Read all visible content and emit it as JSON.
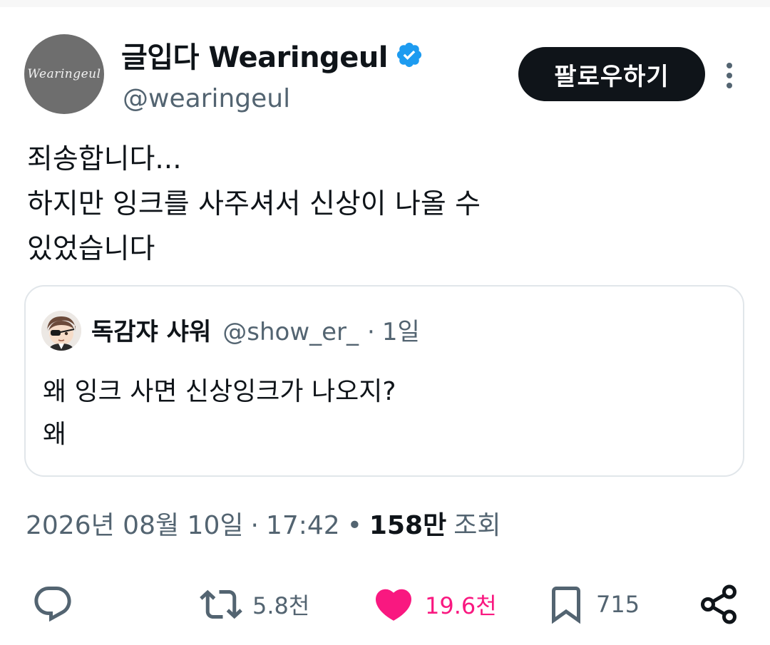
{
  "author": {
    "display_name": "글입다 Wearingeul",
    "handle": "@wearingeul",
    "avatar_text": "Wearingeul",
    "verified": true
  },
  "follow_button": {
    "label": "팔로우하기"
  },
  "tweet": {
    "lines": [
      "죄송합니다...",
      "하지만 잉크를 사주셔서 신상이 나올 수",
      "있었습니다"
    ]
  },
  "quote": {
    "display_name": "독감쟈 샤워",
    "handle": "@show_er_",
    "separator": "·",
    "time": "1일",
    "lines": [
      "왜 잉크 사면 신상잉크가 나오지?",
      "왜"
    ]
  },
  "meta": {
    "date": "2026년 08월 10일",
    "sep1": "·",
    "time": "17:42",
    "sep2": "•",
    "views_count": "158만",
    "views_label": "조회"
  },
  "actions": {
    "reply_count": "",
    "retweet_count": "5.8천",
    "like_count": "19.6천",
    "bookmark_count": "715",
    "liked": true
  },
  "colors": {
    "text": "#0f1419",
    "secondary": "#536471",
    "verified_blue": "#1d9bf0",
    "like_pink": "#f91880",
    "border": "#e1e6ea"
  },
  "icons": [
    "verified-badge-icon",
    "more-options-icon",
    "reply-icon",
    "retweet-icon",
    "heart-icon",
    "bookmark-icon",
    "share-icon"
  ]
}
